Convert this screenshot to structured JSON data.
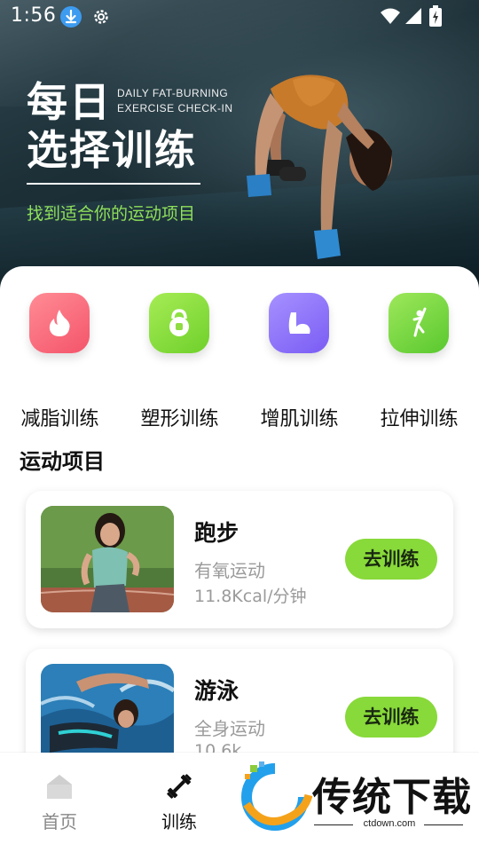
{
  "status_bar": {
    "time": "1:56"
  },
  "hero": {
    "title_line1": "每日",
    "subtitle_en": "DAILY FAT-BURNING EXERCISE CHECK-IN",
    "title_line2": "选择训练",
    "tagline": "找到适合你的运动项目"
  },
  "categories": [
    {
      "label": "减脂训练",
      "icon": "flame-icon",
      "color": "#f4546a"
    },
    {
      "label": "塑形训练",
      "icon": "kettlebell-icon",
      "color": "#6fd02b"
    },
    {
      "label": "增肌训练",
      "icon": "bicep-icon",
      "color": "#7a5cf4"
    },
    {
      "label": "拉伸训练",
      "icon": "stretch-figure-icon",
      "color": "#59c82f"
    }
  ],
  "section_title": "运动项目",
  "workouts": [
    {
      "name": "跑步",
      "type": "有氧运动",
      "kcal": "11.8Kcal/分钟",
      "button": "去训练"
    },
    {
      "name": "游泳",
      "type": "全身运动",
      "kcal": "10.6k",
      "button": "去训练"
    }
  ],
  "bottom_nav": [
    {
      "label": "首页",
      "icon": "home-icon",
      "active": false
    },
    {
      "label": "训练",
      "icon": "training-icon",
      "active": true
    }
  ],
  "watermark": {
    "brand": "传统下载",
    "url": "ctdown.com"
  },
  "colors": {
    "accent_green": "#88d93a",
    "tagline_green": "#8fe05a"
  }
}
